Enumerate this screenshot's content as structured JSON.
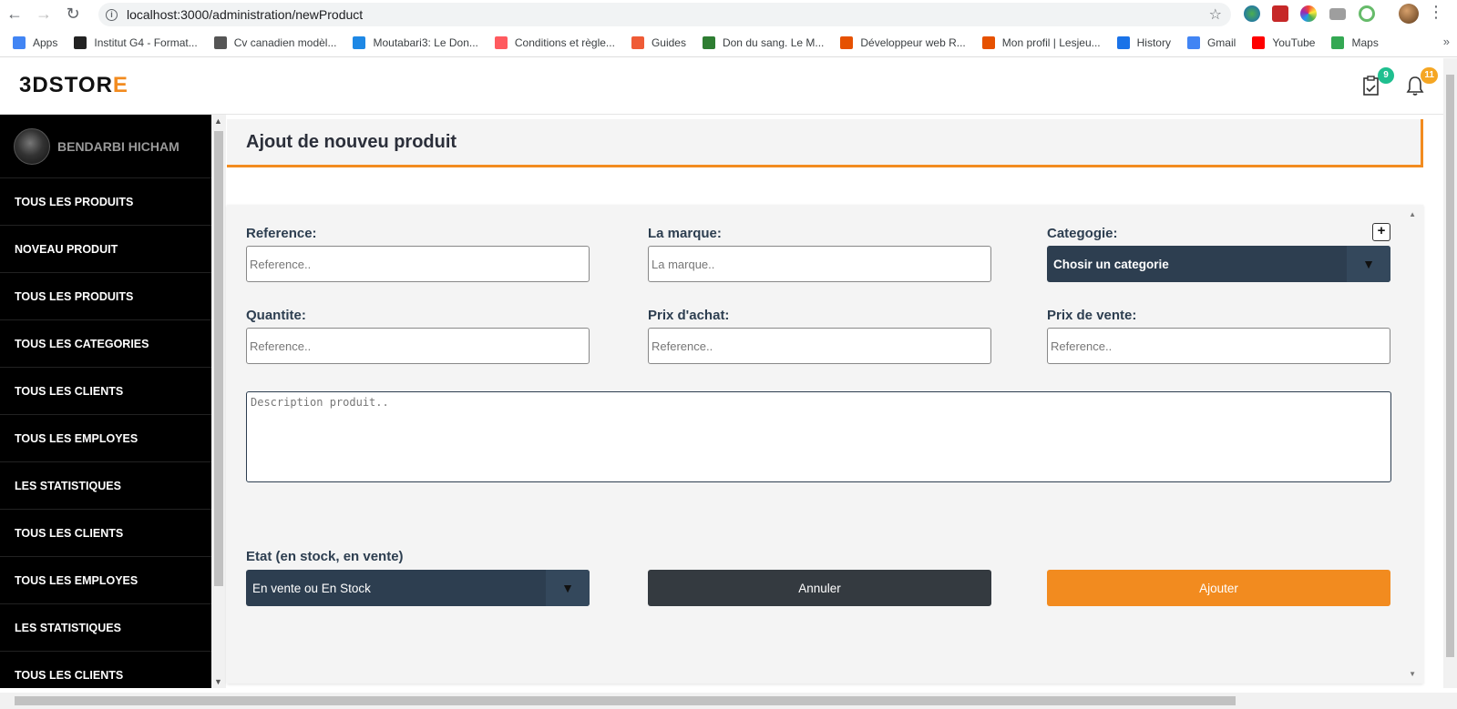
{
  "browser": {
    "url": "localhost:3000/administration/newProduct",
    "bookmarks": [
      {
        "label": "Apps",
        "icon": "apps-grid-icon",
        "color": "#4285f4"
      },
      {
        "label": "Institut G4 - Format...",
        "icon": "g4-icon",
        "color": "#222222"
      },
      {
        "label": "Cv canadien modèl...",
        "icon": "globe-icon",
        "color": "#555555"
      },
      {
        "label": "Moutabari3: Le Don...",
        "icon": "react-icon",
        "color": "#1e88e5"
      },
      {
        "label": "Conditions et règle...",
        "icon": "airbnb-icon",
        "color": "#ff5a5f"
      },
      {
        "label": "Guides",
        "icon": "guides-icon",
        "color": "#ef5b36"
      },
      {
        "label": "Don du sang. Le M...",
        "icon": "e-icon",
        "color": "#2e7d32"
      },
      {
        "label": "Développeur web R...",
        "icon": "lesjeudis-icon",
        "color": "#e65100"
      },
      {
        "label": "Mon profil | Lesjeu...",
        "icon": "lesjeudis-icon",
        "color": "#e65100"
      },
      {
        "label": "History",
        "icon": "history-icon",
        "color": "#1a73e8"
      },
      {
        "label": "Gmail",
        "icon": "google-icon",
        "color": "#4285f4"
      },
      {
        "label": "YouTube",
        "icon": "youtube-icon",
        "color": "#ff0000"
      },
      {
        "label": "Maps",
        "icon": "maps-icon",
        "color": "#34a853"
      }
    ]
  },
  "header": {
    "logo_main": "3DSTOR",
    "logo_accent": "E",
    "orders_badge": "9",
    "notifications_badge": "11",
    "colors": {
      "accent": "#f28b1f",
      "green_badge": "#1fbf8f",
      "orange_badge": "#f5a623"
    }
  },
  "sidebar": {
    "user_name": "BENDARBI HICHAM",
    "items": [
      "TOUS LES PRODUITS",
      "NOVEAU PRODUIT",
      "TOUS LES PRODUITS",
      "TOUS LES CATEGORIES",
      "TOUS LES CLIENTS",
      "TOUS LES EMPLOYES",
      "LES STATISTIQUES",
      "TOUS LES CLIENTS",
      "TOUS LES EMPLOYES",
      "LES STATISTIQUES",
      "TOUS LES CLIENTS"
    ]
  },
  "page": {
    "title": "Ajout de nouveu produit"
  },
  "form": {
    "reference_label": "Reference:",
    "reference_placeholder": "Reference..",
    "brand_label": "La marque:",
    "brand_placeholder": "La marque..",
    "category_label": "Categogie:",
    "category_value": "Chosir un categorie",
    "quantity_label": "Quantite:",
    "quantity_placeholder": "Reference..",
    "purchase_price_label": "Prix d'achat:",
    "purchase_price_placeholder": "Reference..",
    "sale_price_label": "Prix de vente:",
    "sale_price_placeholder": "Reference..",
    "description_placeholder": "Description produit..",
    "state_label": "Etat (en stock, en vente)",
    "state_value": "En vente ou En Stock",
    "cancel_label": "Annuler",
    "submit_label": "Ajouter",
    "add_category_symbol": "+"
  }
}
